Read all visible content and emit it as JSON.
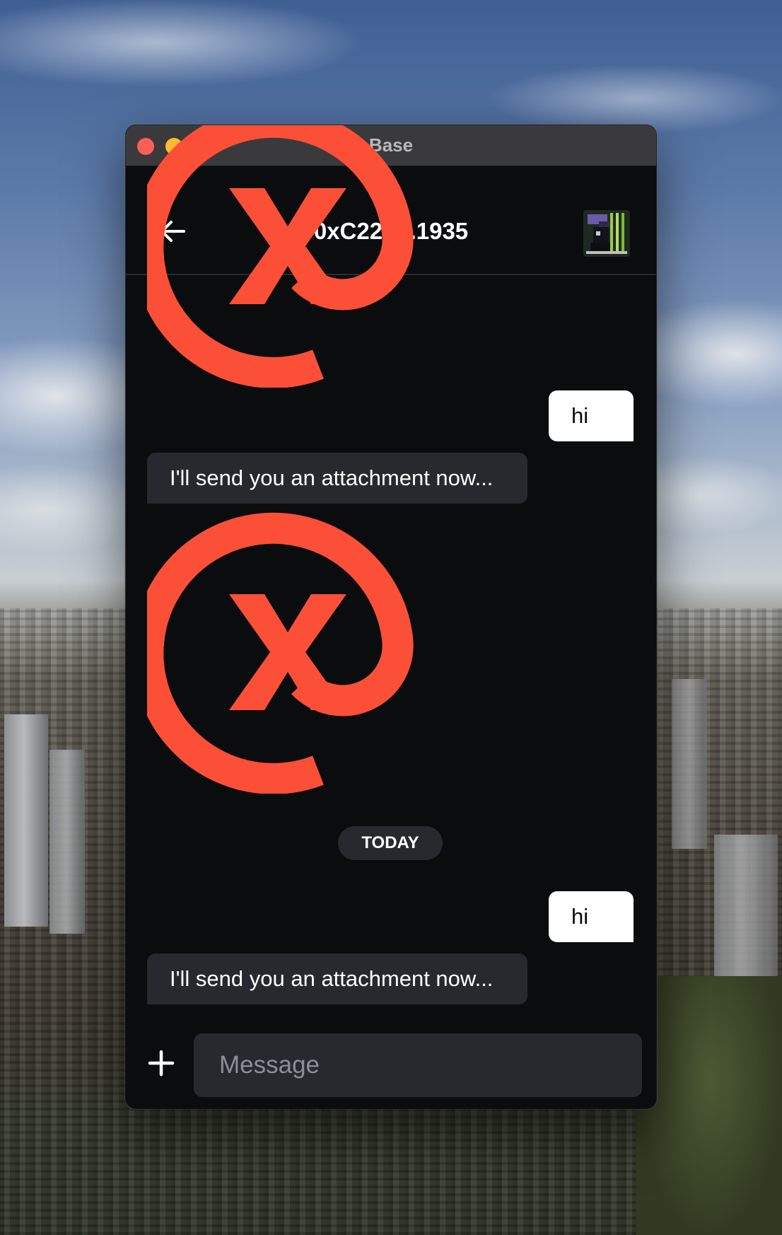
{
  "window": {
    "title": "Base"
  },
  "conversation": {
    "title": "0xC22d...1935",
    "back_icon": "arrow-left-icon",
    "avatar_icon": "pixel-art-avatar"
  },
  "messages": [
    {
      "type": "attachment",
      "direction": "incoming",
      "image": "xmtp-logo",
      "partially_visible": true
    },
    {
      "type": "text",
      "direction": "outgoing",
      "text": "hi"
    },
    {
      "type": "text",
      "direction": "incoming",
      "text": "I'll send you an attachment now..."
    },
    {
      "type": "attachment",
      "direction": "incoming",
      "image": "xmtp-logo"
    },
    {
      "type": "date-separator",
      "text": "TODAY"
    },
    {
      "type": "text",
      "direction": "outgoing",
      "text": "hi"
    },
    {
      "type": "text",
      "direction": "incoming",
      "text": "I'll send you an attachment now..."
    }
  ],
  "composer": {
    "add_icon": "plus-icon",
    "placeholder": "Message",
    "value": ""
  },
  "colors": {
    "background": "#0b0c0e",
    "incoming_bubble": "#27292e",
    "outgoing_bubble": "#ffffff",
    "logo": "#fc4f37"
  }
}
